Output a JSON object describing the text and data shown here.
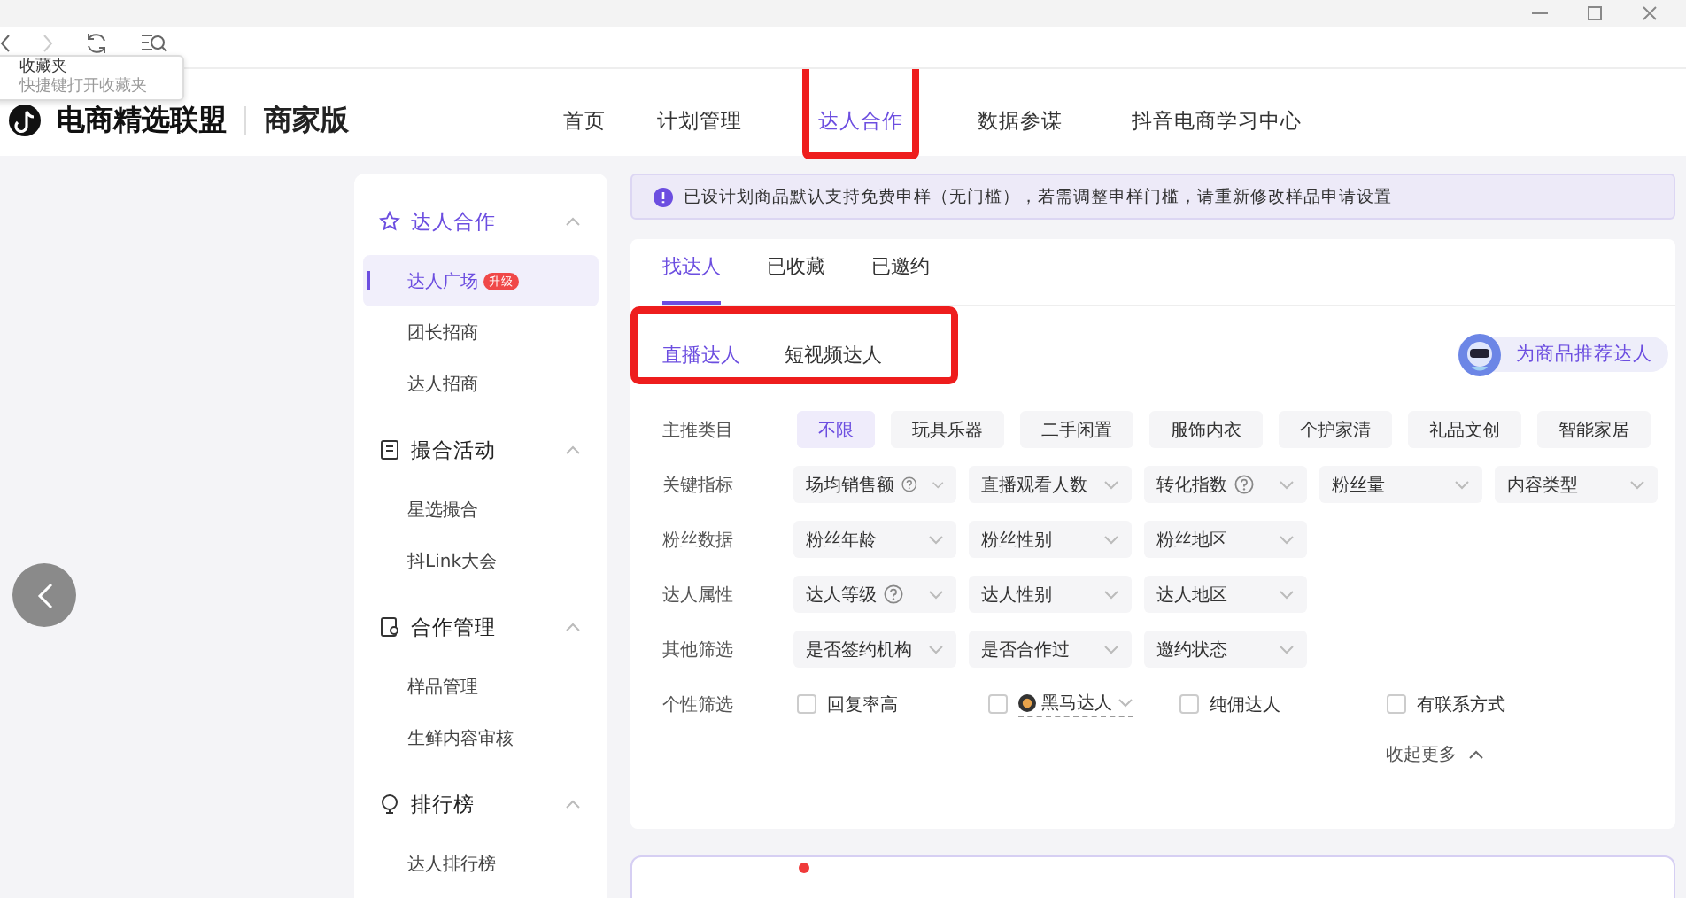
{
  "favorites_tooltip": {
    "title": "收藏夹",
    "hint": "快捷键打开收藏夹"
  },
  "header": {
    "brand": "电商精选联盟",
    "edition": "商家版",
    "nav": [
      {
        "label": "首页",
        "selected": false,
        "highlighted": false
      },
      {
        "label": "计划管理",
        "selected": false,
        "highlighted": false
      },
      {
        "label": "达人合作",
        "selected": true,
        "highlighted": true
      },
      {
        "label": "数据参谋",
        "selected": false,
        "highlighted": false
      },
      {
        "label": "抖音电商学习中心",
        "selected": false,
        "highlighted": false
      }
    ]
  },
  "sidebar": {
    "groups": [
      {
        "title": "达人合作",
        "expanded": true,
        "items": [
          {
            "label": "达人广场",
            "selected": true,
            "badge": "升级"
          },
          {
            "label": "团长招商",
            "selected": false
          },
          {
            "label": "达人招商",
            "selected": false
          }
        ]
      },
      {
        "title": "撮合活动",
        "expanded": true,
        "items": [
          {
            "label": "星选撮合",
            "selected": false
          },
          {
            "label": "抖Link大会",
            "selected": false
          }
        ]
      },
      {
        "title": "合作管理",
        "expanded": true,
        "items": [
          {
            "label": "样品管理",
            "selected": false
          },
          {
            "label": "生鲜内容审核",
            "selected": false
          }
        ]
      },
      {
        "title": "排行榜",
        "expanded": true,
        "items": [
          {
            "label": "达人排行榜",
            "selected": false
          }
        ]
      }
    ]
  },
  "notice": "已设计划商品默认支持免费申样（无门槛），若需调整申样门槛，请重新修改样品申请设置",
  "tabs": [
    {
      "label": "找达人",
      "selected": true
    },
    {
      "label": "已收藏",
      "selected": false
    },
    {
      "label": "已邀约",
      "selected": false
    }
  ],
  "subtabs": {
    "highlighted": true,
    "items": [
      {
        "label": "直播达人",
        "selected": true
      },
      {
        "label": "短视频达人",
        "selected": false
      }
    ]
  },
  "recommend_button": "为商品推荐达人",
  "filters": [
    {
      "label": "主推类目",
      "kind": "chips",
      "options": [
        {
          "label": "不限",
          "selected": true
        },
        {
          "label": "玩具乐器",
          "selected": false
        },
        {
          "label": "二手闲置",
          "selected": false
        },
        {
          "label": "服饰内衣",
          "selected": false
        },
        {
          "label": "个护家清",
          "selected": false
        },
        {
          "label": "礼品文创",
          "selected": false
        },
        {
          "label": "智能家居",
          "selected": false
        }
      ]
    },
    {
      "label": "关键指标",
      "kind": "dropdowns",
      "options": [
        {
          "label": "场均销售额",
          "help": true
        },
        {
          "label": "直播观看人数",
          "help": false
        },
        {
          "label": "转化指数",
          "help": true
        },
        {
          "label": "粉丝量",
          "help": false
        },
        {
          "label": "内容类型",
          "help": false
        }
      ]
    },
    {
      "label": "粉丝数据",
      "kind": "dropdowns",
      "options": [
        {
          "label": "粉丝年龄",
          "help": false
        },
        {
          "label": "粉丝性别",
          "help": false
        },
        {
          "label": "粉丝地区",
          "help": false
        }
      ]
    },
    {
      "label": "达人属性",
      "kind": "dropdowns",
      "options": [
        {
          "label": "达人等级",
          "help": true
        },
        {
          "label": "达人性别",
          "help": false
        },
        {
          "label": "达人地区",
          "help": false
        }
      ]
    },
    {
      "label": "其他筛选",
      "kind": "dropdowns",
      "options": [
        {
          "label": "是否签约机构",
          "help": false
        },
        {
          "label": "是否合作过",
          "help": false
        },
        {
          "label": "邀约状态",
          "help": false
        }
      ]
    },
    {
      "label": "个性筛选",
      "kind": "checkboxes",
      "options": [
        {
          "label": "回复率高",
          "checked": false,
          "kind": "plain"
        },
        {
          "label": "黑马达人",
          "checked": false,
          "kind": "menu"
        },
        {
          "label": "纯佣达人",
          "checked": false,
          "kind": "plain"
        },
        {
          "label": "有联系方式",
          "checked": false,
          "kind": "plain"
        }
      ]
    }
  ],
  "collapse_more": "收起更多"
}
